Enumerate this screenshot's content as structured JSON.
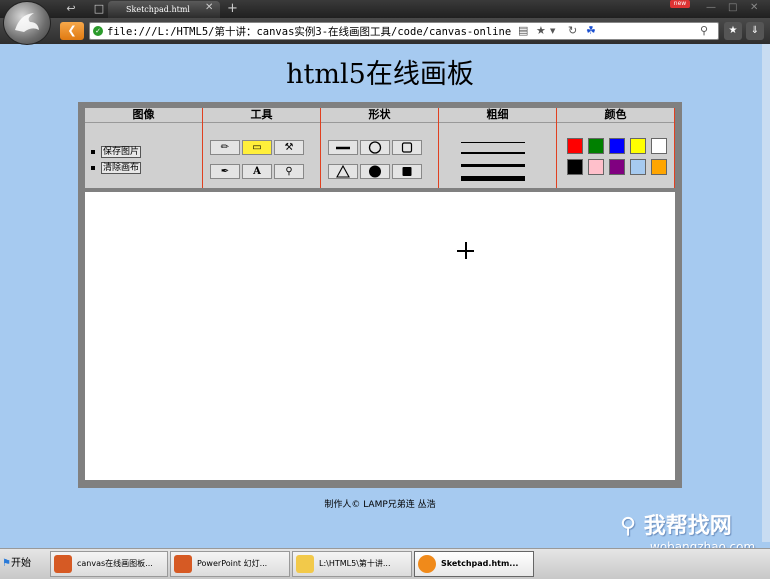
{
  "browser": {
    "tab_title": "Sketchpad.html",
    "url": "file:///L:/HTML5/第十讲：canvas实例3-在线画图工具/code/canvas-online",
    "new_badge": "new"
  },
  "page": {
    "title": "html5在线画板",
    "credit": "制作人© LAMP兄弟连 丛浩"
  },
  "toolbar": {
    "image": {
      "heading": "图像",
      "save": "保存图片",
      "clear": "清除画布"
    },
    "tools": {
      "heading": "工具"
    },
    "shapes": {
      "heading": "形状"
    },
    "thickness": {
      "heading": "粗细",
      "levels": [
        1,
        2,
        3,
        4
      ]
    },
    "colors": {
      "heading": "颜色",
      "palette": [
        "#ff0000",
        "#008000",
        "#0000ff",
        "#ffff00",
        "#ffffff",
        "#000000",
        "#ffc0cb",
        "#800080",
        "#a6caf0",
        "#ffa500"
      ]
    }
  },
  "watermark": {
    "cn": "我帮找网",
    "en": "wobangzhao.com"
  },
  "taskbar": {
    "start": "开始",
    "tasks": [
      "canvas在线画图板...",
      "PowerPoint 幻灯...",
      "L:\\HTML5\\第十讲...",
      "Sketchpad.htm..."
    ]
  }
}
